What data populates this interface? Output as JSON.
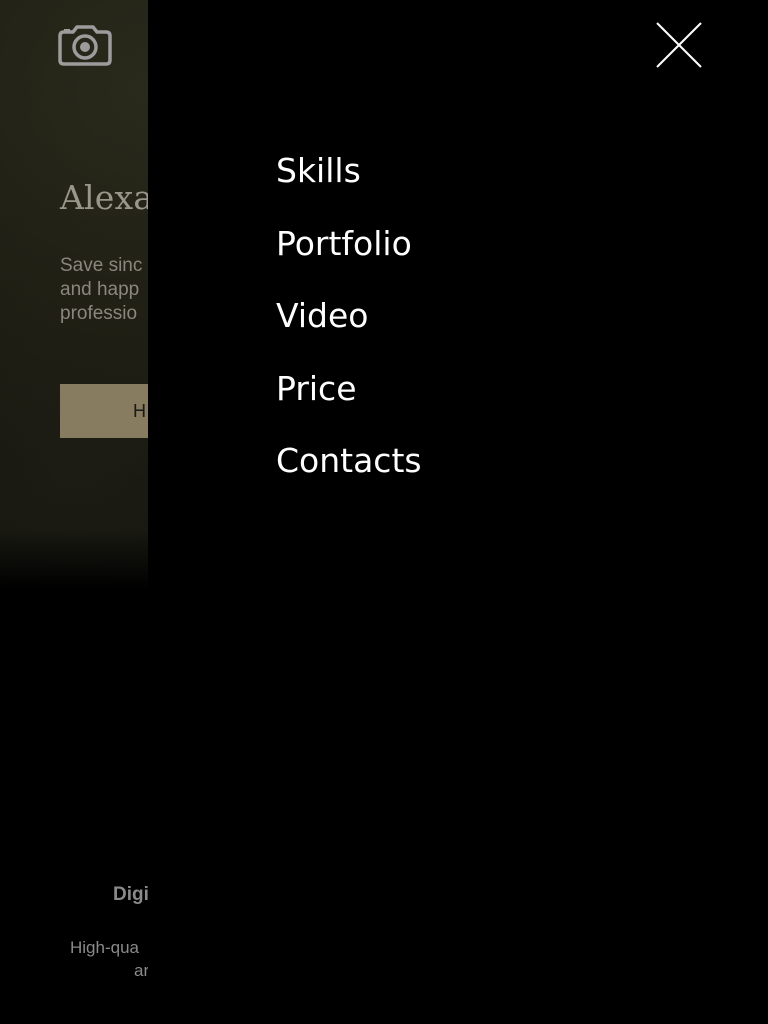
{
  "hero": {
    "title": "Alexa",
    "text_lines": [
      "Save sinc",
      "and happ",
      "professio"
    ],
    "button_label": "H"
  },
  "feature": {
    "title": "Digi",
    "text_lines": [
      "High-qua",
      "ar"
    ]
  },
  "menu": {
    "items": [
      "Skills",
      "Portfolio",
      "Video",
      "Price",
      "Contacts"
    ]
  },
  "icons": {
    "logo": "camera-icon",
    "close": "close-icon"
  },
  "colors": {
    "menu_background": "#000000",
    "menu_text": "#ffffff",
    "button_background": "#877b60"
  }
}
